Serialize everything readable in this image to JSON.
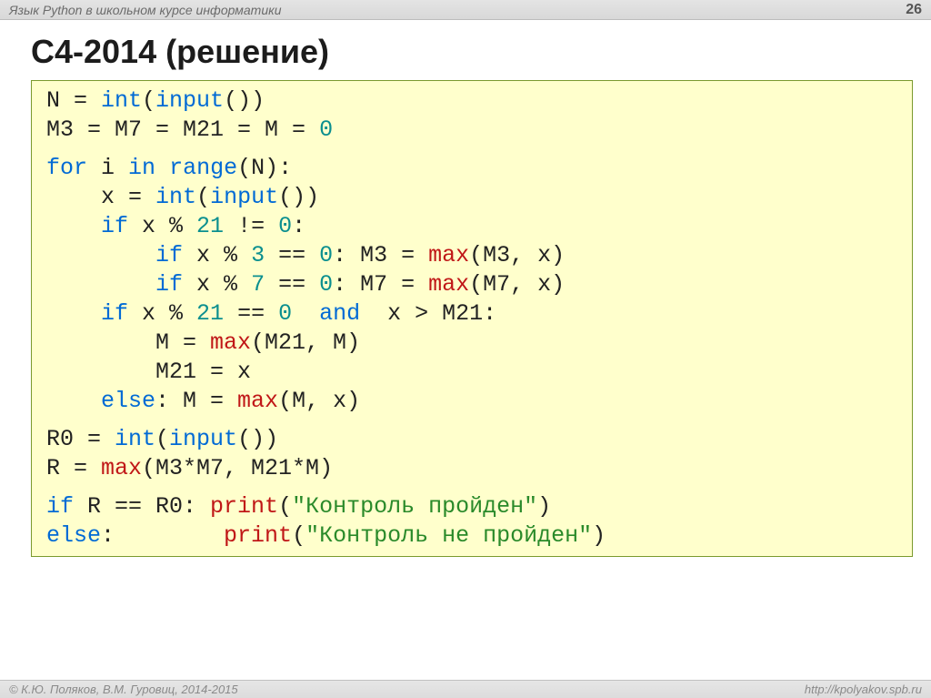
{
  "header": {
    "title": "Язык Python в школьном курсе информатики",
    "page_number": "26"
  },
  "slide": {
    "title": "C4-2014 (решение)"
  },
  "code": {
    "l01_a": "N = ",
    "l01_b": "int",
    "l01_c": "(",
    "l01_d": "input",
    "l01_e": "())",
    "l02": "M3 = M7 = M21 = M = ",
    "l02_n": "0",
    "l03_a": "for",
    "l03_b": " i ",
    "l03_c": "in",
    "l03_d": " ",
    "l03_e": "range",
    "l03_f": "(N):",
    "l04_a": "    x = ",
    "l04_b": "int",
    "l04_c": "(",
    "l04_d": "input",
    "l04_e": "())",
    "l05_a": "    ",
    "l05_b": "if",
    "l05_c": " x % ",
    "l05_d": "21",
    "l05_e": " != ",
    "l05_f": "0",
    "l05_g": ":",
    "l06_a": "        ",
    "l06_b": "if",
    "l06_c": " x % ",
    "l06_d": "3",
    "l06_e": " == ",
    "l06_f": "0",
    "l06_g": ": M3 = ",
    "l06_h": "max",
    "l06_i": "(M3, x)",
    "l07_a": "        ",
    "l07_b": "if",
    "l07_c": " x % ",
    "l07_d": "7",
    "l07_e": " == ",
    "l07_f": "0",
    "l07_g": ": M7 = ",
    "l07_h": "max",
    "l07_i": "(M7, x)",
    "l08_a": "    ",
    "l08_b": "if",
    "l08_c": " x % ",
    "l08_d": "21",
    "l08_e": " == ",
    "l08_f": "0",
    "l08_g": "  ",
    "l08_h": "and",
    "l08_i": "  x > M21:",
    "l09_a": "        M = ",
    "l09_b": "max",
    "l09_c": "(M21, M)",
    "l10": "        M21 = x",
    "l11_a": "    ",
    "l11_b": "else",
    "l11_c": ": M = ",
    "l11_d": "max",
    "l11_e": "(M, x)",
    "l12_a": "R0 = ",
    "l12_b": "int",
    "l12_c": "(",
    "l12_d": "input",
    "l12_e": "())",
    "l13_a": "R = ",
    "l13_b": "max",
    "l13_c": "(M3*M7, M21*M)",
    "l14_a": "if",
    "l14_b": " R == R0: ",
    "l14_c": "print",
    "l14_d": "(",
    "l14_e": "\"Контроль пройден\"",
    "l14_f": ")",
    "l15_a": "else",
    "l15_b": ":        ",
    "l15_c": "print",
    "l15_d": "(",
    "l15_e": "\"Контроль не пройден\"",
    "l15_f": ")"
  },
  "footer": {
    "left": "© К.Ю. Поляков, В.М. Гуровиц, 2014-2015",
    "right": "http://kpolyakov.spb.ru"
  }
}
